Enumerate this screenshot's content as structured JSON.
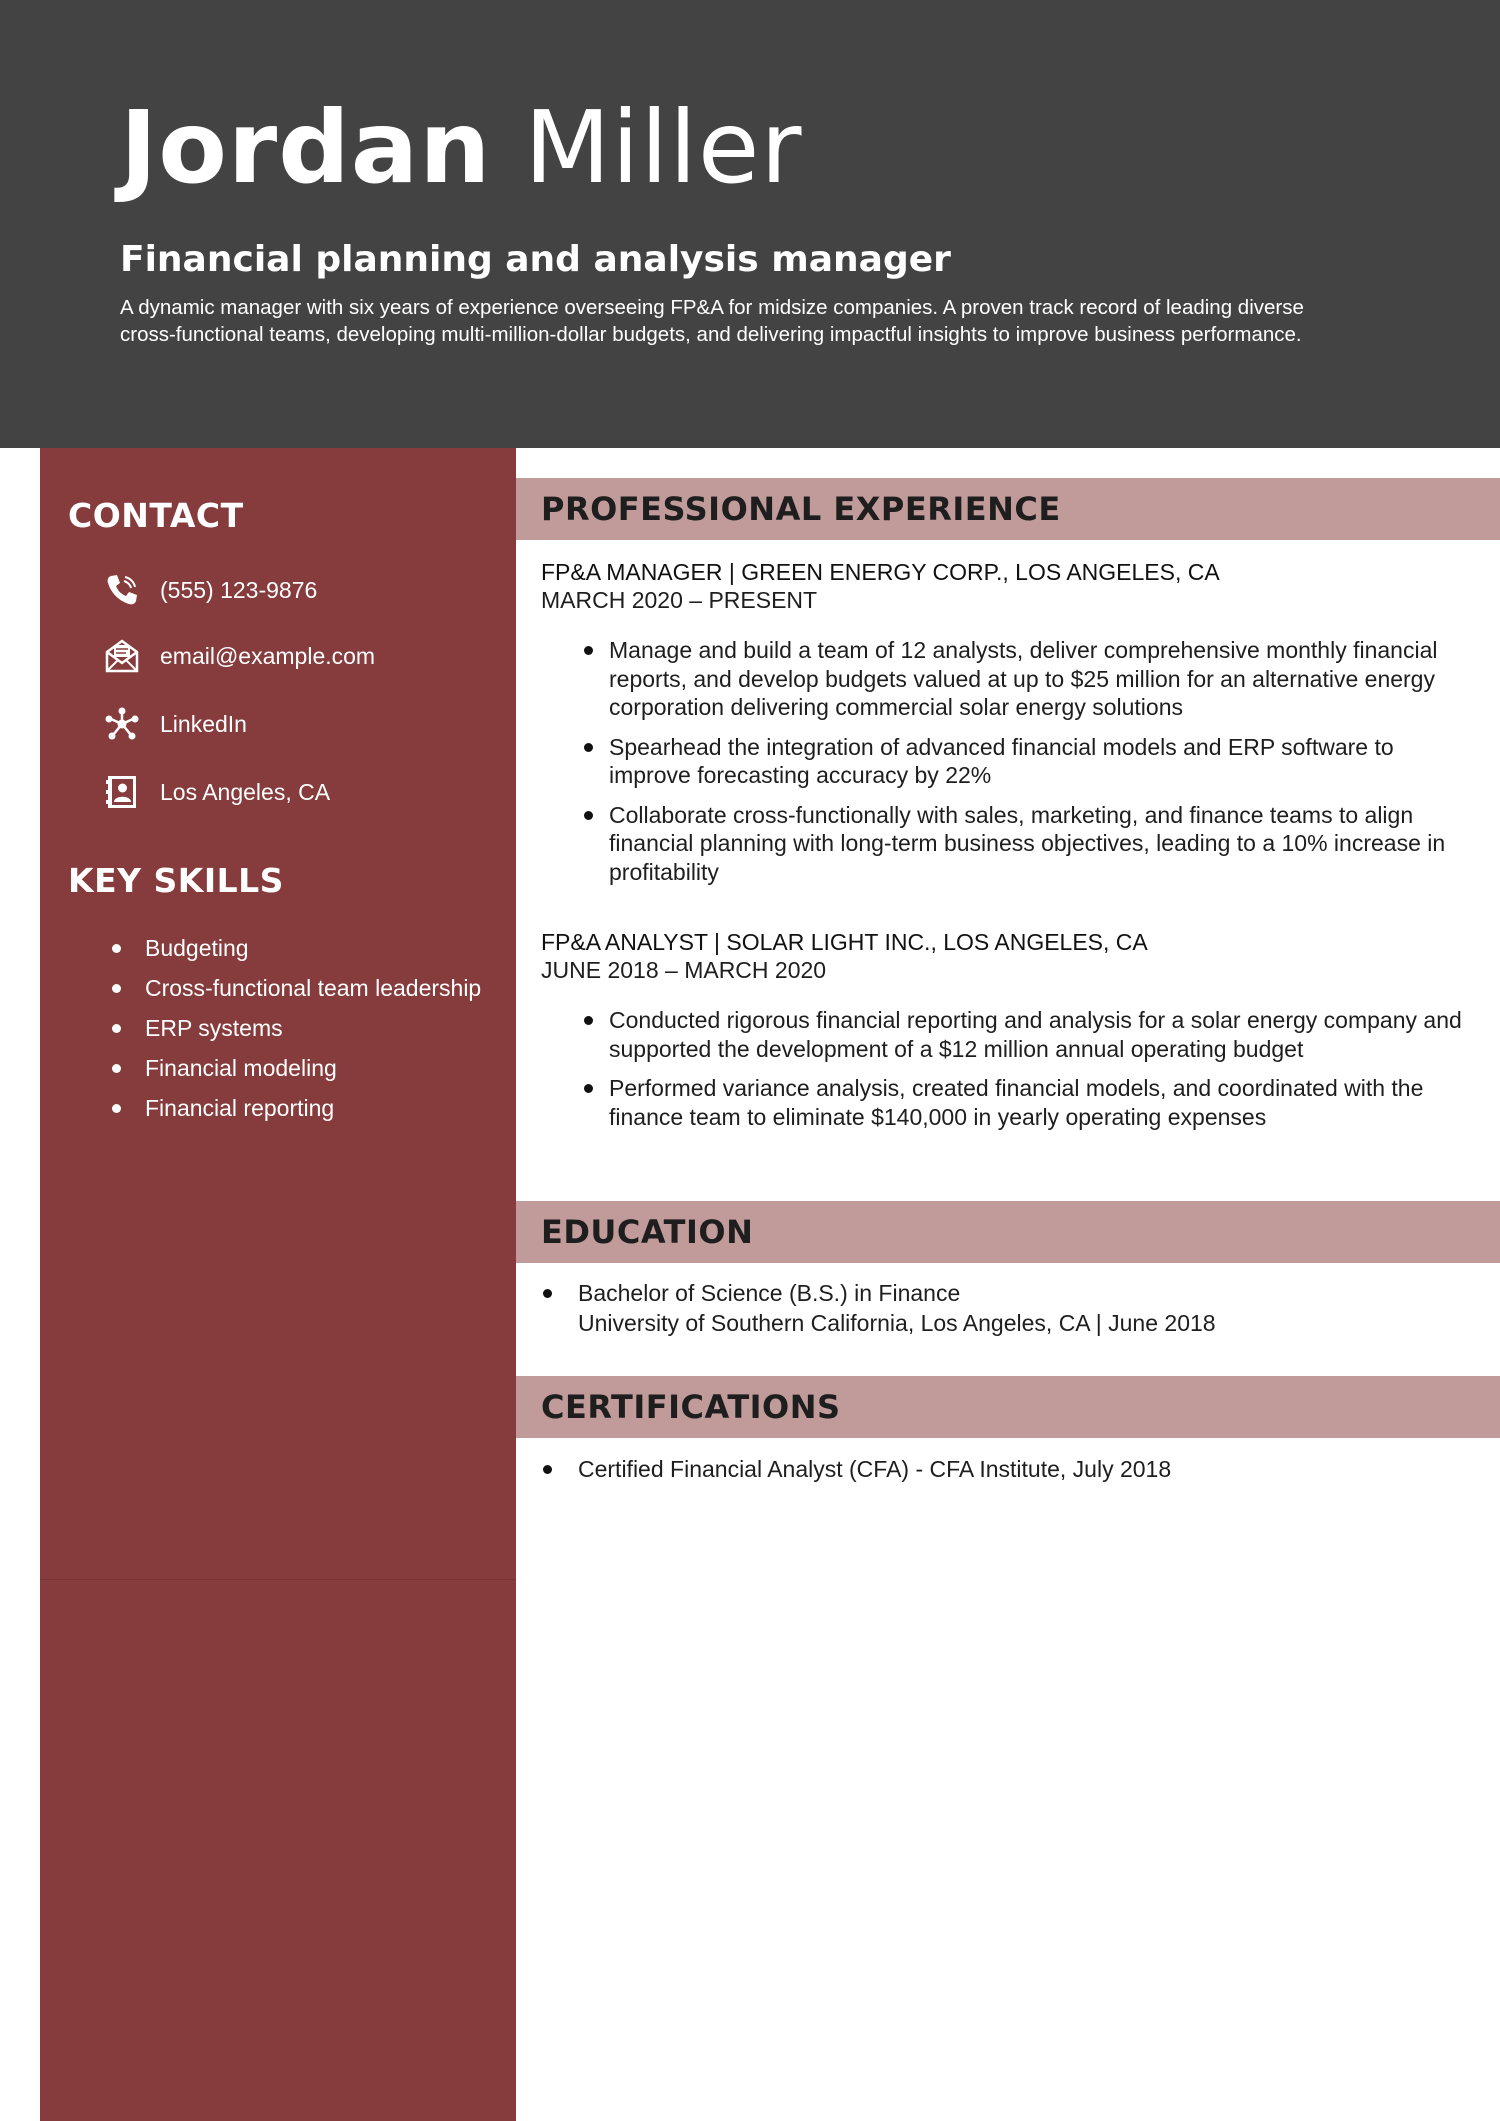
{
  "header": {
    "first_name": "Jordan",
    "last_name": "Miller",
    "title": "Financial planning and analysis manager",
    "summary": "A dynamic manager with six years of experience overseeing FP&A for midsize companies. A proven track record of leading diverse cross-functional teams, developing multi-million-dollar budgets, and delivering impactful insights to improve business performance."
  },
  "contact": {
    "heading": "CONTACT",
    "items": [
      {
        "icon": "phone-icon",
        "text": "(555) 123-9876"
      },
      {
        "icon": "envelope-icon",
        "text": "email@example.com"
      },
      {
        "icon": "network-icon",
        "text": "LinkedIn"
      },
      {
        "icon": "address-card-icon",
        "text": "Los Angeles, CA"
      }
    ]
  },
  "skills": {
    "heading": "KEY SKILLS",
    "items": [
      "Budgeting",
      "Cross-functional team leadership",
      "ERP systems",
      "Financial modeling",
      "Financial reporting"
    ]
  },
  "experience": {
    "heading": "PROFESSIONAL EXPERIENCE",
    "jobs": [
      {
        "header": "FP&A MANAGER | GREEN ENERGY CORP., LOS ANGELES, CA",
        "dates": "MARCH 2020 – PRESENT",
        "bullets": [
          "Manage and build a team of 12 analysts, deliver comprehensive monthly financial reports, and develop budgets valued at up to $25 million for an alternative energy corporation delivering commercial solar energy solutions",
          "Spearhead the integration of advanced financial models and ERP software to improve forecasting accuracy by 22%",
          "Collaborate cross-functionally with sales, marketing, and finance teams to align financial planning with long-term business objectives, leading to a 10% increase in profitability"
        ]
      },
      {
        "header": "FP&A ANALYST | SOLAR LIGHT INC., LOS ANGELES, CA",
        "dates": "JUNE 2018 – MARCH 2020",
        "bullets": [
          "Conducted rigorous financial reporting and analysis for a solar energy company and supported the development of a $12 million annual operating budget",
          "Performed variance analysis, created financial models, and coordinated with the finance team to eliminate $140,000 in yearly operating expenses"
        ]
      }
    ]
  },
  "education": {
    "heading": "EDUCATION",
    "degree": "Bachelor of Science (B.S.) in Finance",
    "school": "University of Southern California, Los Angeles, CA | June 2018"
  },
  "certifications": {
    "heading": "CERTIFICATIONS",
    "items": [
      "Certified Financial Analyst (CFA) - CFA Institute, July 2018"
    ]
  },
  "colors": {
    "header_bg": "#434343",
    "sidebar_bg": "#863b3c",
    "section_band": "#c19a9a"
  }
}
